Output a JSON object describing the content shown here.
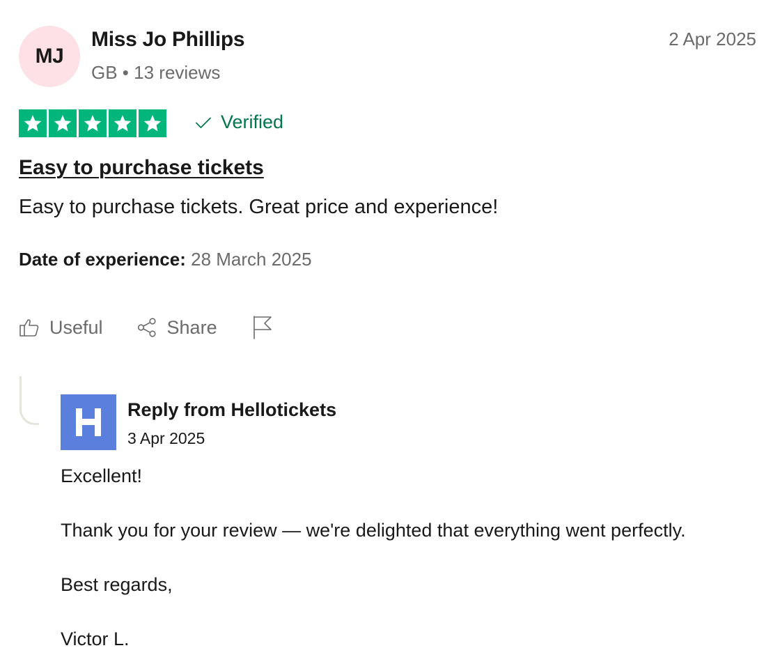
{
  "reviewer": {
    "initials": "MJ",
    "name": "Miss Jo Phillips",
    "country": "GB",
    "review_count": "13 reviews"
  },
  "review": {
    "date": "2 Apr 2025",
    "rating": 5,
    "rating_max": 5,
    "star_color": "#00b67a",
    "verified_label": "Verified",
    "verified_color": "#04764b",
    "title": "Easy to purchase tickets",
    "body": "Easy to purchase tickets. Great price and experience!",
    "experience_label": "Date of experience:",
    "experience_date": "28 March 2025"
  },
  "actions": {
    "useful_label": "Useful",
    "share_label": "Share",
    "useful_icon": "thumbs-up-icon",
    "share_icon": "share-icon",
    "report_icon": "flag-icon"
  },
  "reply": {
    "from": "Reply from Hellotickets",
    "date": "3 Apr 2025",
    "logo_color": "#5b7fdd",
    "paragraphs": [
      "Excellent!",
      "Thank you for your review — we're delighted that everything went perfectly.",
      "Best regards,",
      "Victor L."
    ]
  }
}
